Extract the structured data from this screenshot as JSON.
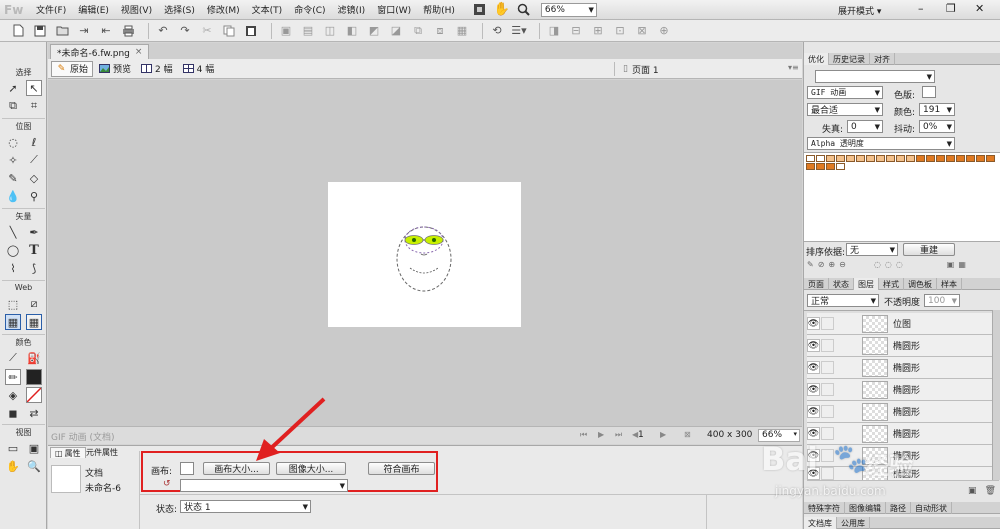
{
  "app": {
    "logo": "Fw",
    "menus": [
      "文件(F)",
      "编辑(E)",
      "视图(V)",
      "选择(S)",
      "修改(M)",
      "文本(T)",
      "命令(C)",
      "滤镜(I)",
      "窗口(W)",
      "帮助(H)"
    ],
    "zoom": "66%",
    "workspace": "展开模式",
    "window_controls": [
      "–",
      "❐",
      "✕"
    ]
  },
  "tools": {
    "sections": [
      "选择",
      "位图",
      "矢量",
      "Web",
      "颜色",
      "视图"
    ]
  },
  "document": {
    "tab": "*未命名-6.fw.png",
    "tab_close": "×",
    "views": [
      "原始",
      "预览",
      "2 幅",
      "4 幅"
    ],
    "page": "页面 1"
  },
  "status": {
    "text": "GIF 动画 (文档)",
    "frame": "1",
    "size": "400 x 300",
    "zoom": "66%"
  },
  "properties": {
    "tabs": [
      "属性",
      "元件属性"
    ],
    "doc_type": "文档",
    "doc_name": "未命名-6",
    "canvas_label": "画布:",
    "buttons": [
      "画布大小...",
      "图像大小...",
      "符合画布"
    ],
    "state_label": "状态:",
    "state_value": "状态 1"
  },
  "optimize": {
    "tabs": [
      "优化",
      "历史记录",
      "对齐"
    ],
    "format": "GIF 动画",
    "colors_label": "色版:",
    "palette": "最合适",
    "num_colors_label": "颜色:",
    "num_colors": "191",
    "loss_label": "失真:",
    "loss": "0",
    "dither_label": "抖动:",
    "dither": "0%",
    "transparency": "Alpha 透明度",
    "sort_label": "排序依据:",
    "sort_value": "无",
    "rebuild": "重建"
  },
  "layers": {
    "tabs": [
      "页面",
      "状态",
      "图层",
      "样式",
      "调色板",
      "样本"
    ],
    "blend": "正常",
    "opacity_label": "不透明度",
    "opacity": "100",
    "items": [
      "位图",
      "椭圆形",
      "椭圆形",
      "椭圆形",
      "椭圆形",
      "椭圆形",
      "椭圆形",
      "椭圆形"
    ]
  },
  "bottom_tabs": [
    "特殊字符",
    "图像编辑",
    "路径",
    "自动形状"
  ],
  "bottom_tabs2": [
    "文档库",
    "公用库"
  ],
  "watermark": {
    "brand": "Bai",
    "brand2": "经验",
    "url": "jingyan.baidu.com"
  },
  "colors": {
    "highlight": "#e02020",
    "swatch_main": "#e07a22",
    "swatch_light": "#f3c18c",
    "face_glasses": "#c8f000"
  }
}
